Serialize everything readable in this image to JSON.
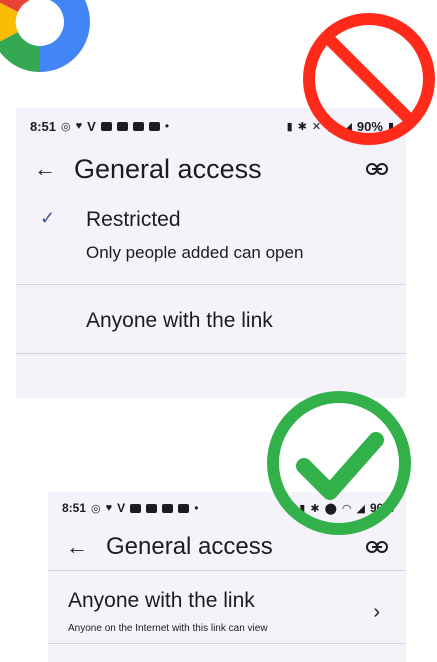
{
  "colors": {
    "bad": "#ff2a1a",
    "good": "#32b14a",
    "panel_bg": "#f6f2fa",
    "check": "#3d5a8e"
  },
  "top_screen": {
    "status": {
      "time": "8:51",
      "carrier": "V",
      "battery": "90%"
    },
    "title": "General access",
    "options": [
      {
        "label": "Restricted",
        "desc": "Only people added can open",
        "selected": true
      },
      {
        "label": "Anyone with the link"
      }
    ]
  },
  "bottom_screen": {
    "status": {
      "time": "8:51",
      "carrier": "V",
      "battery": "90%"
    },
    "title": "General access",
    "option": {
      "label": "Anyone with the link",
      "desc": "Anyone on the Internet with this link can view"
    }
  },
  "icons": {
    "logo": "google-g-logo",
    "back": "arrow-left-icon",
    "link": "link-icon",
    "check": "check-icon",
    "chevron": "chevron-right-icon",
    "bad": "prohibited-icon",
    "good": "checkmark-circle-icon"
  }
}
